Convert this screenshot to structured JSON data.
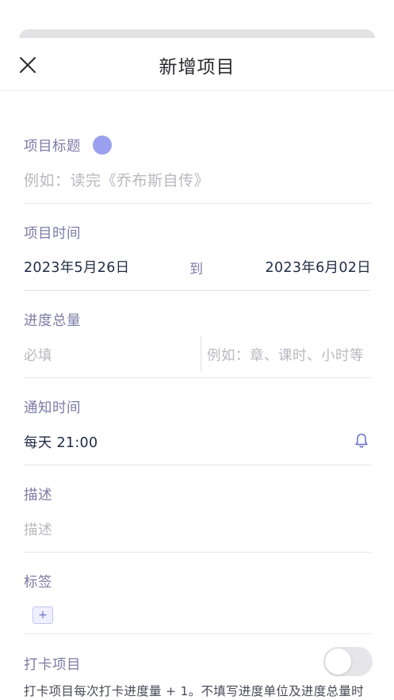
{
  "header": {
    "title": "新增项目"
  },
  "title_section": {
    "label": "项目标题",
    "placeholder": "例如：读完《乔布斯自传》",
    "color_dot": "#9b9ff0"
  },
  "time_section": {
    "label": "项目时间",
    "start_date": "2023年5月26日",
    "to": "到",
    "end_date": "2023年6月02日"
  },
  "progress_section": {
    "label": "进度总量",
    "total_placeholder": "必填",
    "unit_placeholder": "例如：章、课时、小时等"
  },
  "notify_section": {
    "label": "通知时间",
    "value": "每天 21:00"
  },
  "description_section": {
    "label": "描述",
    "placeholder": "描述"
  },
  "tags_section": {
    "label": "标签",
    "add_label": "+"
  },
  "checkin_section": {
    "label": "打卡项目",
    "toggle_on": false,
    "description": "打卡项目每次打卡进度量 + 1。不填写进度单位及进度总量时"
  },
  "colors": {
    "accent": "#6b70c8",
    "label": "#7b7ba8",
    "value": "#1f2a44"
  }
}
